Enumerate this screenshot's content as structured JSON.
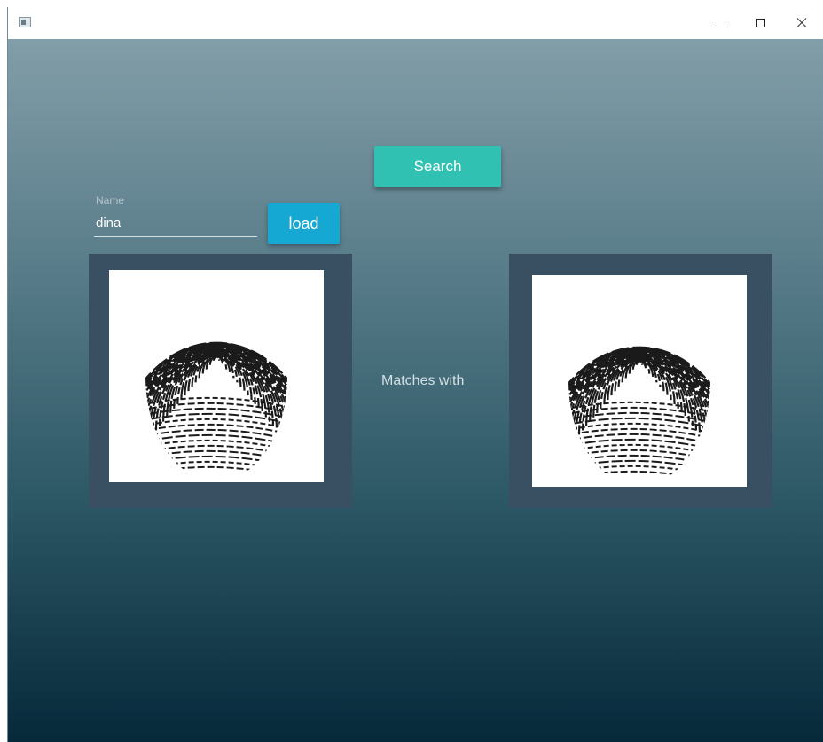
{
  "window": {
    "controls": {
      "minimize_icon": "minimize-icon",
      "maximize_icon": "maximize-icon",
      "close_icon": "close-icon"
    }
  },
  "toolbar": {
    "search_label": "Search"
  },
  "form": {
    "name_label": "Name",
    "name_value": "dina",
    "load_label": "load"
  },
  "comparison": {
    "matches_text": "Matches with",
    "left_image": "fingerprint-image",
    "right_image": "fingerprint-image"
  },
  "colors": {
    "search_button": "#31c1b3",
    "load_button": "#14a8d2",
    "frame": "#385061",
    "gradient_top": "#829ea8",
    "gradient_bottom": "#06293a"
  }
}
